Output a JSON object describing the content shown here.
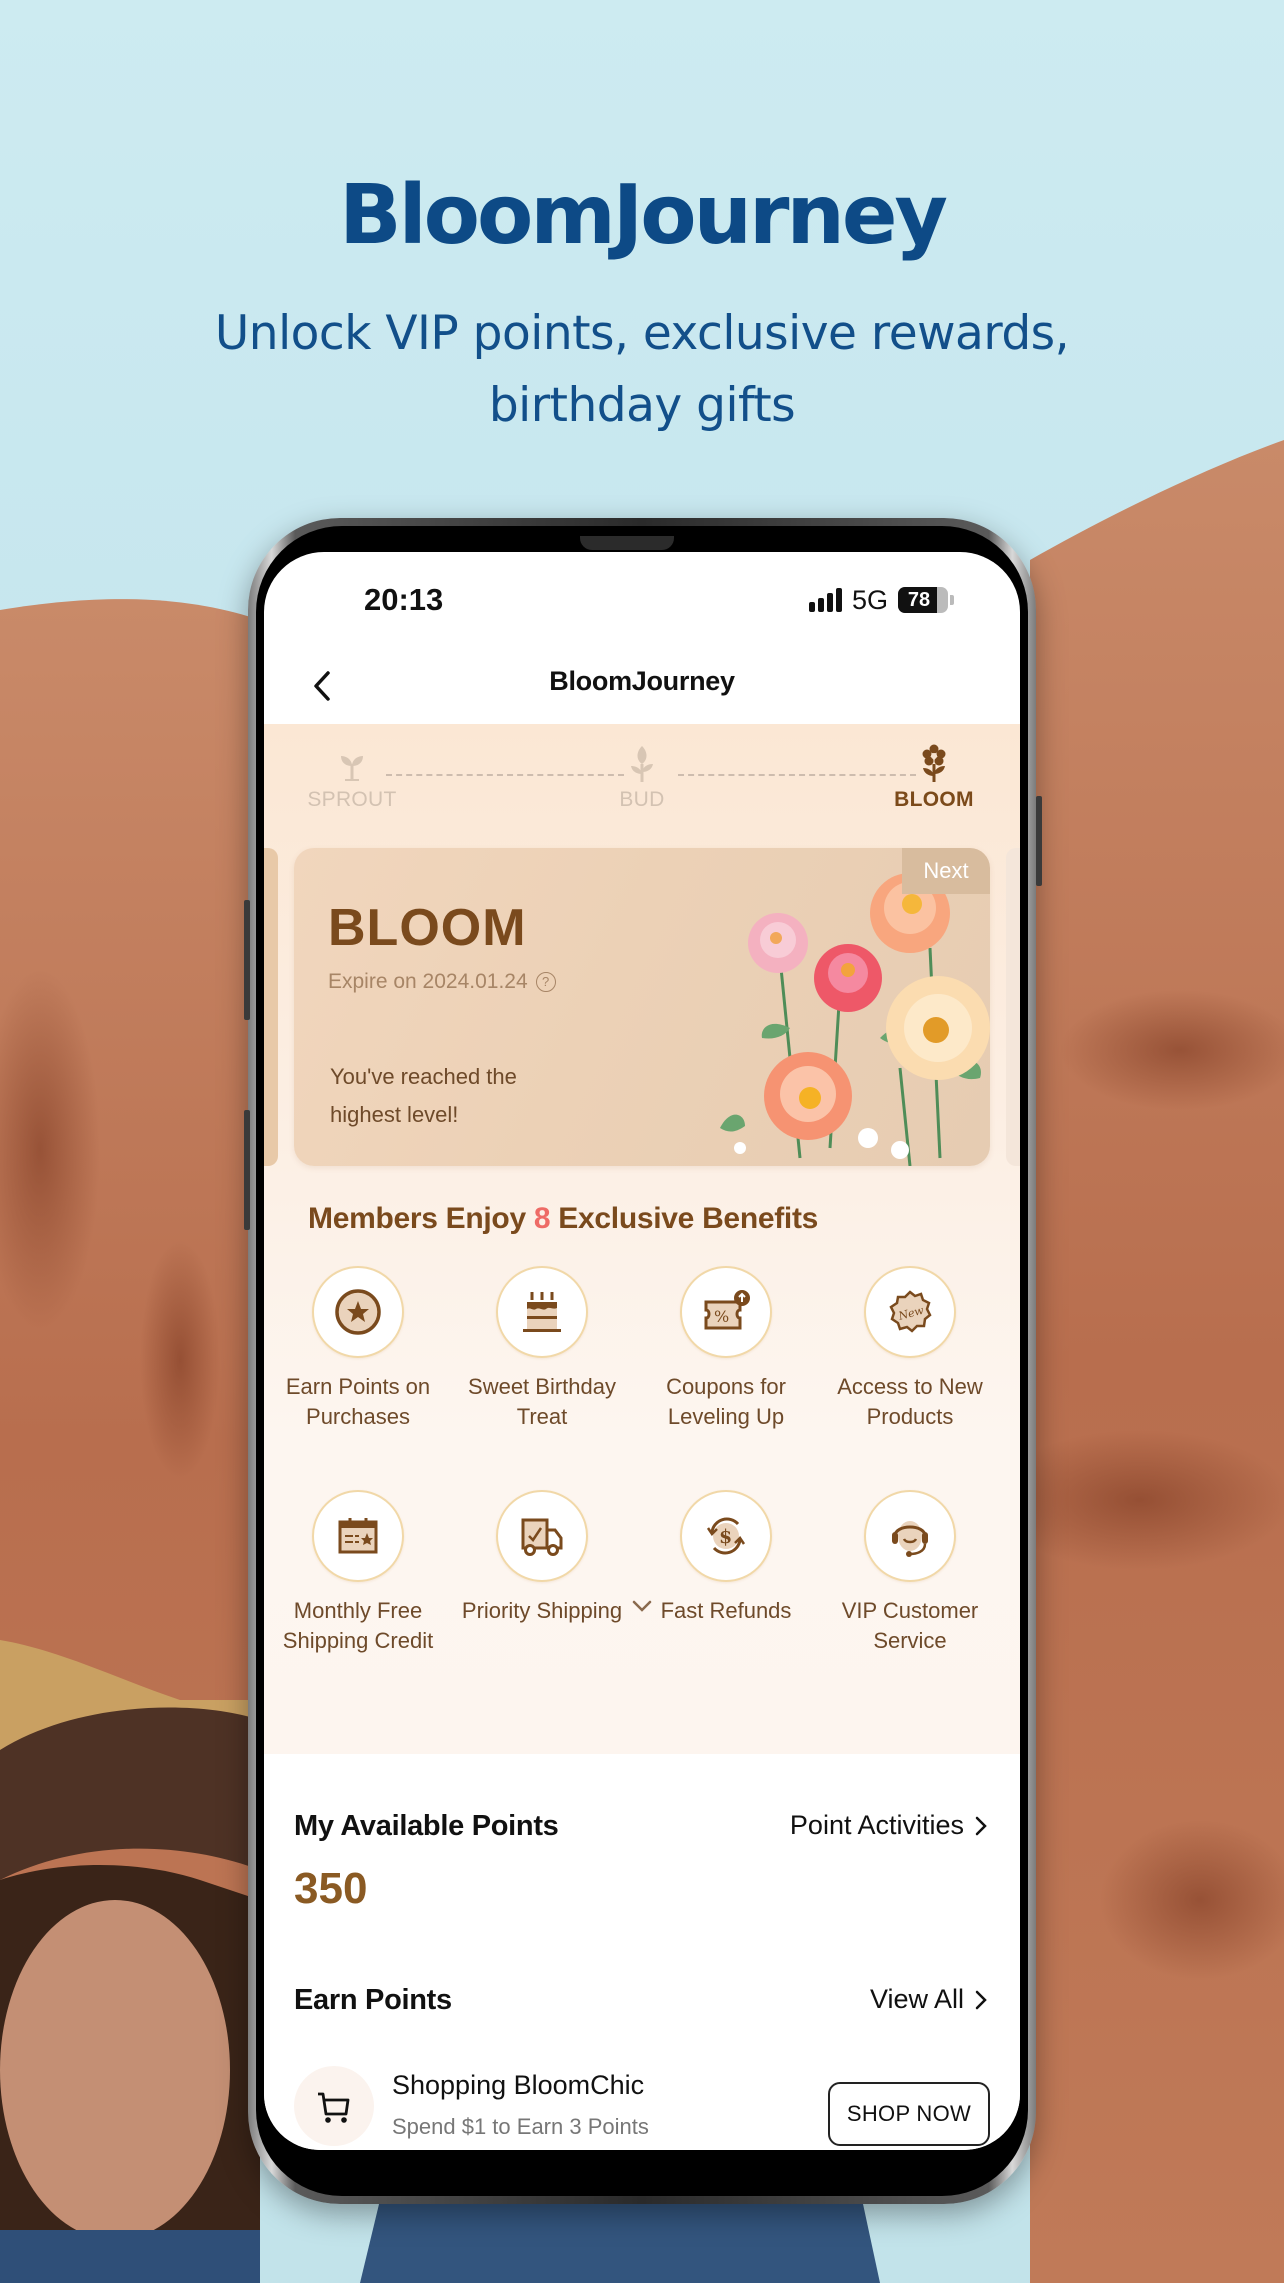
{
  "promo": {
    "headline": "BloomJourney",
    "subhead": "Unlock VIP points, exclusive rewards, birthday gifts"
  },
  "status_bar": {
    "time": "20:13",
    "network": "5G",
    "battery": "78",
    "battery_level": 0.78
  },
  "nav": {
    "title": "BloomJourney",
    "back_icon": "chevron-left-icon"
  },
  "progress": {
    "steps": [
      {
        "label": "SPROUT",
        "icon": "sprout-icon",
        "state": "inactive"
      },
      {
        "label": "BUD",
        "icon": "bud-icon",
        "state": "inactive"
      },
      {
        "label": "BLOOM",
        "icon": "flower-icon",
        "state": "active"
      }
    ]
  },
  "tier_card": {
    "badge": "Next",
    "tier": "BLOOM",
    "expire": "Expire on 2024.01.24",
    "help_icon": "?",
    "message": "You've reached the highest level!"
  },
  "benefits": {
    "title_before": "Members Enjoy ",
    "count": "8",
    "title_after": " Exclusive Benefits",
    "items": [
      {
        "label": "Earn Points on Purchases",
        "icon": "star-coin-icon"
      },
      {
        "label": "Sweet Birthday Treat",
        "icon": "birthday-cake-icon"
      },
      {
        "label": "Coupons for Leveling Up",
        "icon": "coupon-icon"
      },
      {
        "label": "Access to New Products",
        "icon": "new-badge-icon"
      },
      {
        "label": "Monthly Free Shipping Credit",
        "icon": "calendar-icon"
      },
      {
        "label": "Priority Shipping",
        "icon": "truck-icon"
      },
      {
        "label": "Fast Refunds",
        "icon": "refund-icon"
      },
      {
        "label": "VIP Customer Service",
        "icon": "headset-icon"
      }
    ],
    "badge_text": "New"
  },
  "points": {
    "title": "My Available Points",
    "link": "Point Activities",
    "value": "350"
  },
  "earn": {
    "title": "Earn Points",
    "link": "View All",
    "tasks": [
      {
        "name": "Shopping BloomChic",
        "desc": "Spend $1 to Earn 3 Points",
        "button": "SHOP NOW",
        "icon": "cart-icon"
      }
    ]
  },
  "colors": {
    "brand_brown": "#7a4a1d",
    "accent_red": "#ee6b66",
    "headline_blue": "#0d4a86"
  }
}
